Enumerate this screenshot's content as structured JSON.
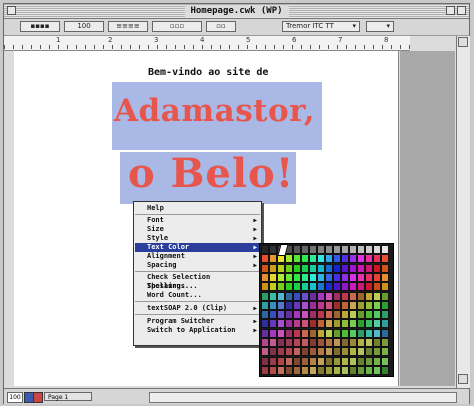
{
  "window": {
    "title": "Homepage.cwk (WP)"
  },
  "toolbar": {
    "zoom_value": "100",
    "font_name": "Tremor ITC TT",
    "font_size": ""
  },
  "ruler": {
    "numbers": [
      "1",
      "2",
      "3",
      "4",
      "5",
      "6",
      "7",
      "8"
    ]
  },
  "document": {
    "heading": "Bem-vindo ao site de",
    "line1": "Adamastor,",
    "line2": "o Belo!"
  },
  "context_menu": {
    "items": [
      {
        "label": "Help",
        "submenu": false
      },
      {
        "label": "Font",
        "submenu": true
      },
      {
        "label": "Size",
        "submenu": true
      },
      {
        "label": "Style",
        "submenu": true
      },
      {
        "label": "Text Color",
        "submenu": true,
        "highlighted": true
      },
      {
        "label": "Alignment",
        "submenu": true
      },
      {
        "label": "Spacing",
        "submenu": true
      },
      {
        "label": "Check Selection Spelling...",
        "submenu": false
      },
      {
        "label": "Thesaurus...",
        "submenu": false
      },
      {
        "label": "Word Count...",
        "submenu": false
      },
      {
        "label": "textSOAP 2.0 (Clip)",
        "submenu": true
      },
      {
        "label": "Program Switcher",
        "submenu": true
      },
      {
        "label": "Switch to Application",
        "submenu": true
      }
    ]
  },
  "status": {
    "zoom": "100",
    "page_label": "Page 1"
  },
  "colors": {
    "menu_highlight": "#2b3e9c",
    "title_red": "#e6564c",
    "title_bg": "#aab8e6"
  }
}
